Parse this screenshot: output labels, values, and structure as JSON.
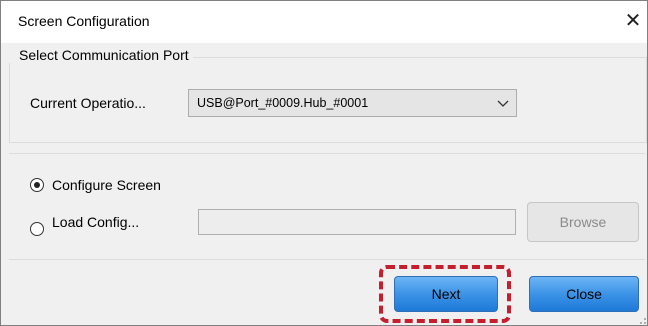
{
  "window": {
    "title": "Screen Configuration",
    "close_glyph": "✕"
  },
  "port_group": {
    "legend": "Select Communication Port",
    "current_label": "Current Operatio...",
    "port_value": "USB@Port_#0009.Hub_#0001"
  },
  "config_group": {
    "configure_label": "Configure Screen",
    "configure_selected": true,
    "load_label": "Load Config...",
    "load_selected": false,
    "path_value": "",
    "browse_label": "Browse"
  },
  "footer": {
    "next_label": "Next",
    "close_label": "Close"
  },
  "colors": {
    "highlight": "#c51f2e",
    "button_blue": "#3c93e6"
  }
}
